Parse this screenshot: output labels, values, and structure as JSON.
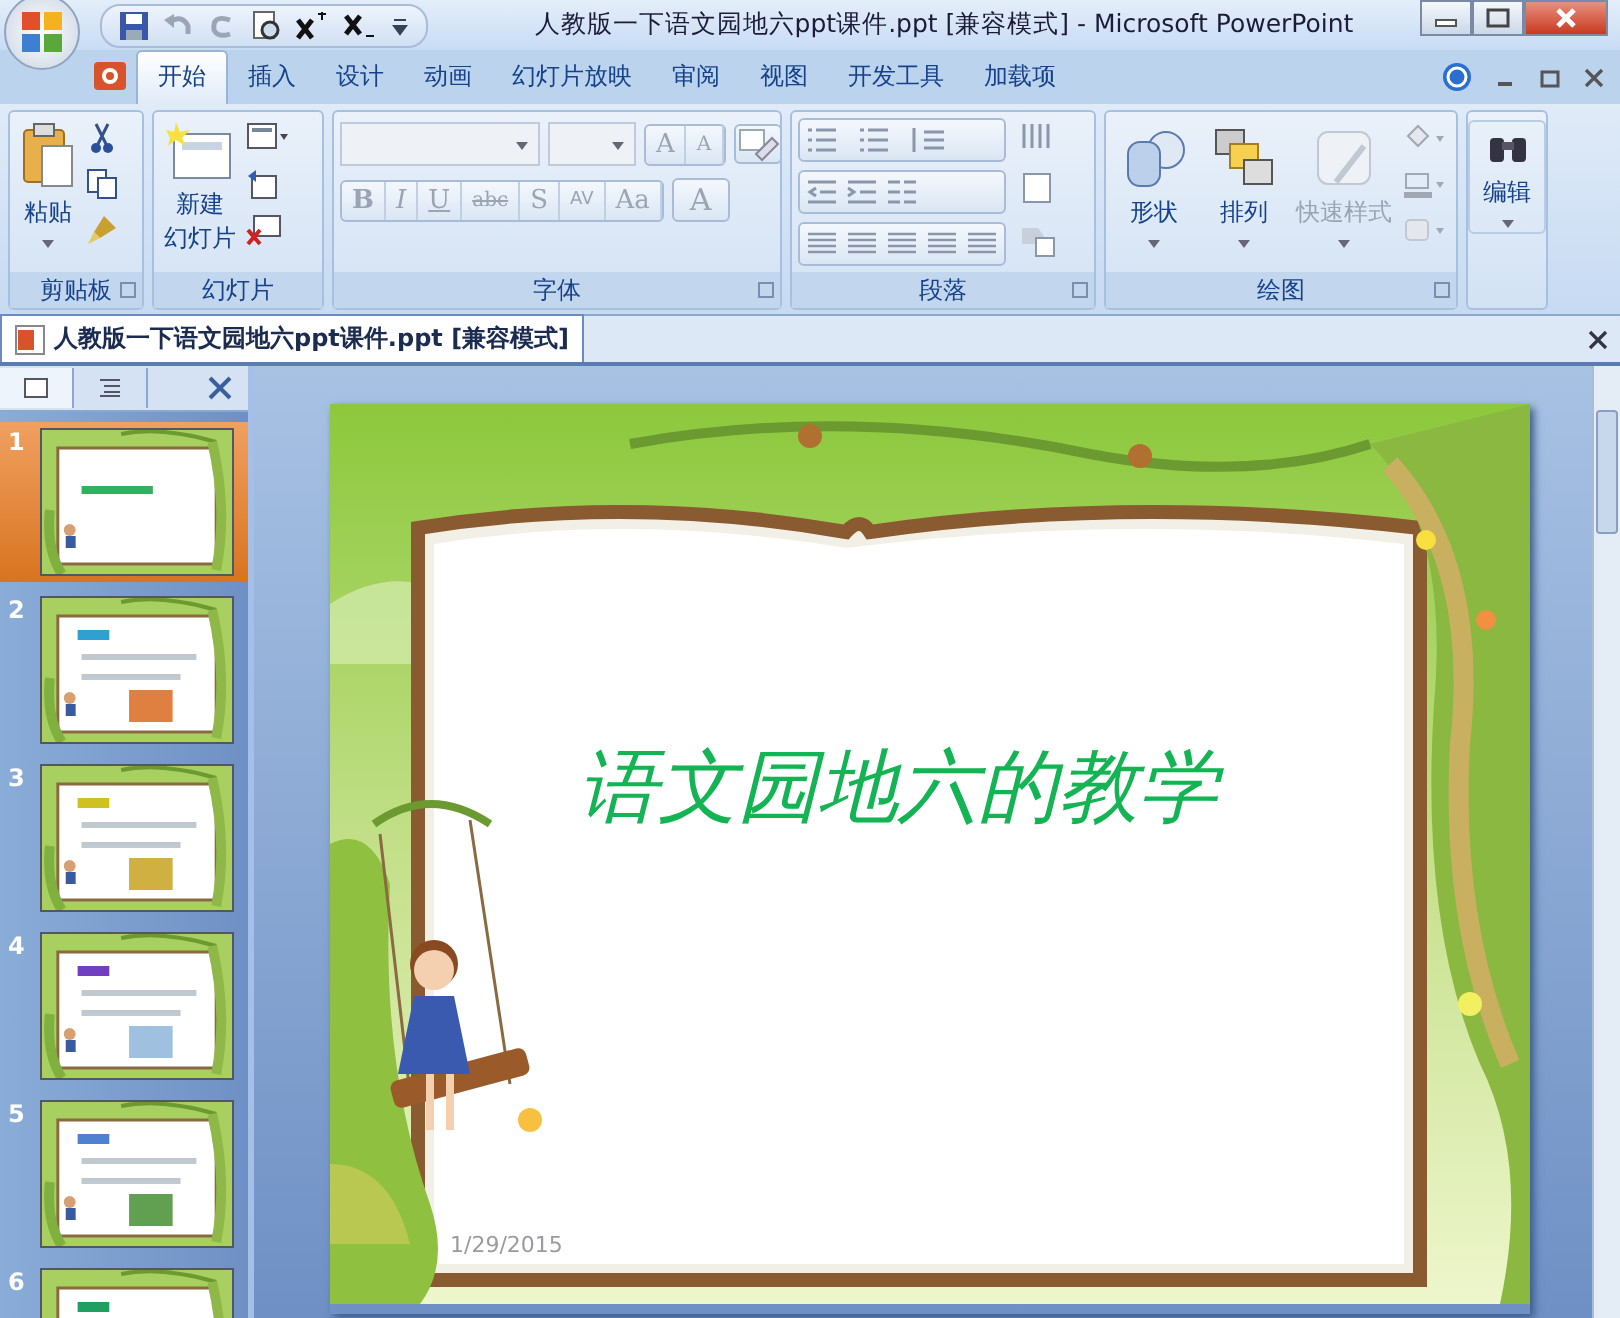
{
  "window": {
    "title": "人教版一下语文园地六ppt课件.ppt [兼容模式] - Microsoft PowerPoint"
  },
  "ribbon_tabs": [
    {
      "label": "开始",
      "selected": true
    },
    {
      "label": "插入",
      "selected": false
    },
    {
      "label": "设计",
      "selected": false
    },
    {
      "label": "动画",
      "selected": false
    },
    {
      "label": "幻灯片放映",
      "selected": false
    },
    {
      "label": "审阅",
      "selected": false
    },
    {
      "label": "视图",
      "selected": false
    },
    {
      "label": "开发工具",
      "selected": false
    },
    {
      "label": "加载项",
      "selected": false
    }
  ],
  "ribbon": {
    "clipboard": {
      "label": "剪贴板",
      "paste": "粘贴"
    },
    "slides": {
      "label": "幻灯片",
      "new_slide": [
        "新建",
        "幻灯片"
      ]
    },
    "font": {
      "label": "字体",
      "disabled": true,
      "size_buttons": [
        "A",
        "A"
      ],
      "format_buttons": [
        "B",
        "I",
        "U",
        "abc",
        "S",
        "AV",
        "Aa"
      ],
      "color_button": "A"
    },
    "paragraph": {
      "label": "段落"
    },
    "drawing": {
      "label": "绘图",
      "buttons": [
        {
          "label": "形状",
          "disabled": false
        },
        {
          "label": "排列",
          "disabled": false
        },
        {
          "label": "快速样式",
          "disabled": true
        }
      ]
    },
    "editing": {
      "button": "编辑"
    }
  },
  "document_tab": {
    "title": "人教版一下语文园地六ppt课件.ppt [兼容模式]"
  },
  "slide_panel": {
    "thumbnails": [
      {
        "number": "1",
        "selected": true
      },
      {
        "number": "2",
        "selected": false
      },
      {
        "number": "3",
        "selected": false
      },
      {
        "number": "4",
        "selected": false
      },
      {
        "number": "5",
        "selected": false
      },
      {
        "number": "6",
        "selected": false
      }
    ]
  },
  "slide": {
    "title": "语文园地六的教学",
    "date": "1/29/2015"
  }
}
